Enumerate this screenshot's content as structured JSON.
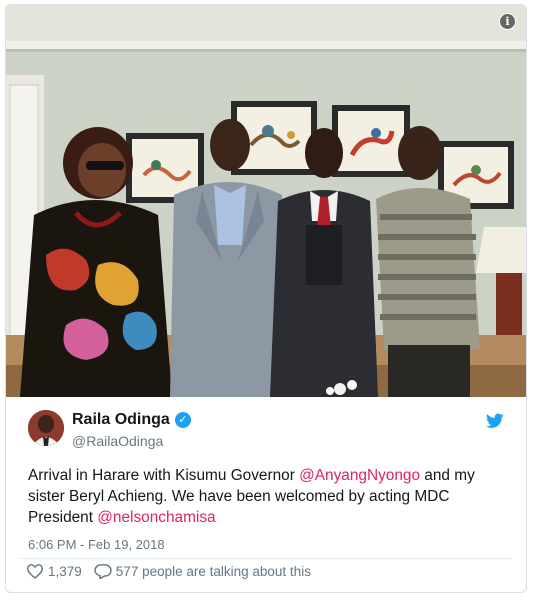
{
  "tweet": {
    "display_name": "Raila Odinga",
    "handle": "@RailaOdinga",
    "text_before_mention_1": "Arrival in Harare with Kisumu Governor ",
    "mention_1": "@AnyangNyongo",
    "text_before_mention_2": " and my sister Beryl Achieng. We have been welcomed by acting MDC President ",
    "mention_2": "@nelsonchamisa",
    "timestamp": "6:06 PM - Feb 19, 2018",
    "likes": "1,379",
    "talking": "577 people are talking about this"
  },
  "icons": {
    "info": "info-icon",
    "verified": "verified-badge-icon",
    "brand": "twitter-bird-icon",
    "like": "heart-icon",
    "reply": "speech-bubble-icon"
  },
  "colors": {
    "mention": "#e0245e",
    "verified": "#1da1f2",
    "muted": "#657786",
    "brand": "#1da1f2"
  },
  "media": {
    "info_glyph": "i"
  }
}
